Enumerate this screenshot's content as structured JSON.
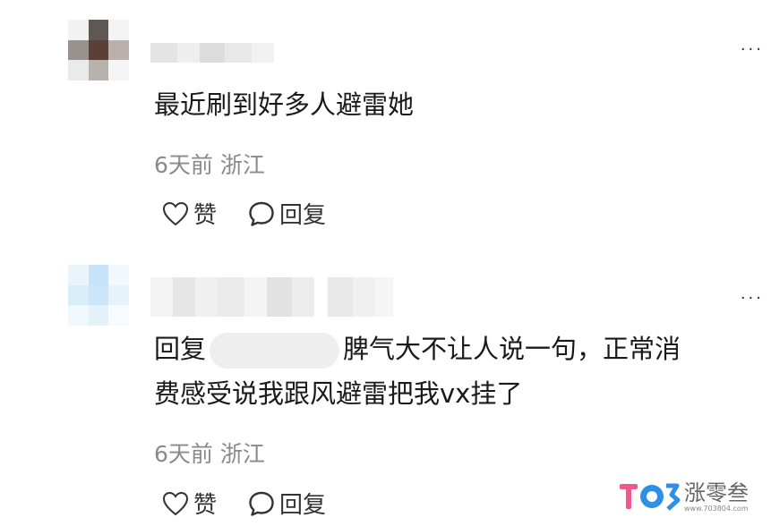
{
  "comments": [
    {
      "text": "最近刷到好多人避雷她",
      "time": "6天前",
      "location": "浙江",
      "like_label": "赞",
      "reply_label": "回复",
      "more": "..."
    },
    {
      "reply_prefix": "回复",
      "text_line1": "脾气大不让人说一句，正常消",
      "text_line2": "费感受说我跟风避雷把我vx挂了",
      "time": "6天前",
      "location": "浙江",
      "like_label": "赞",
      "reply_label": "回复",
      "more": "..."
    }
  ],
  "watermark": {
    "title": "涨零叁",
    "url": "www.703804.com"
  },
  "colors": {
    "meta_gray": "#8a8a8a",
    "watermark_blue": "#2f8fe6",
    "watermark_pink": "#f05a8a"
  }
}
